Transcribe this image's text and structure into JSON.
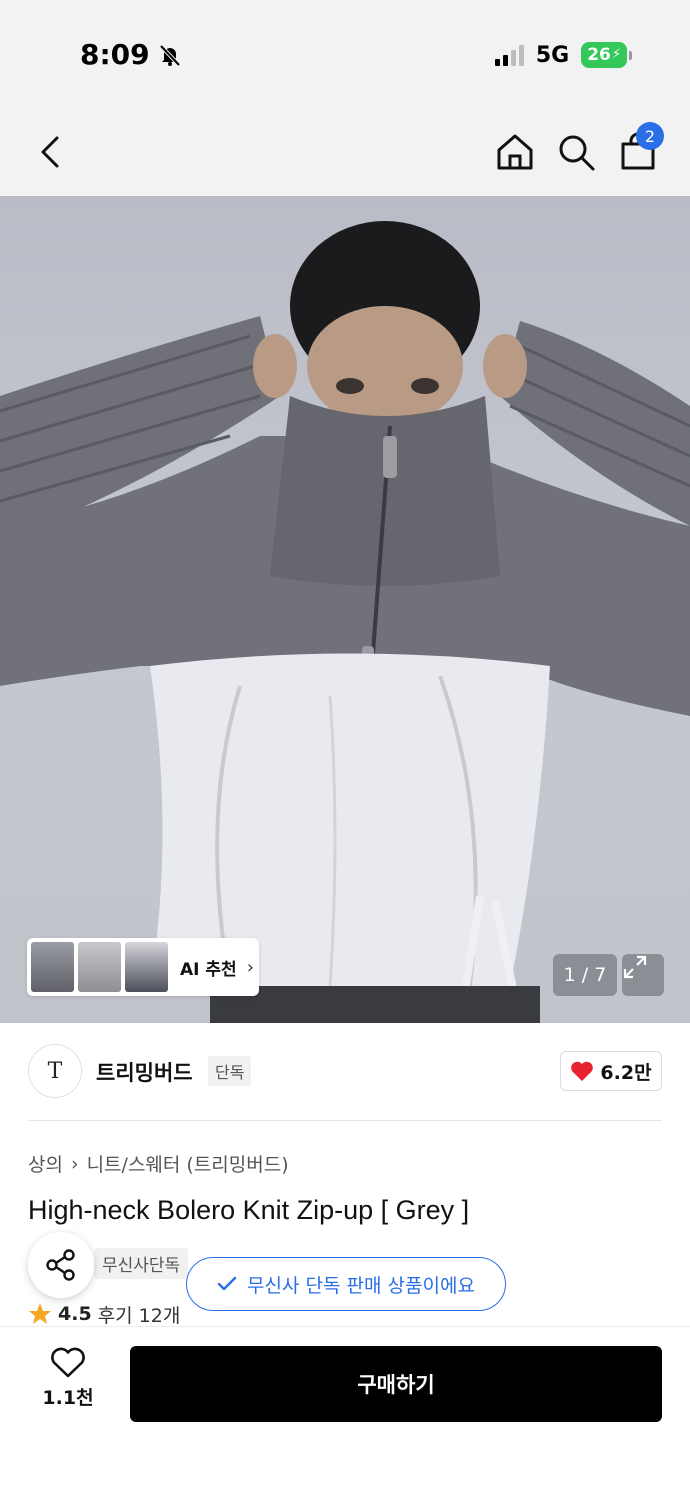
{
  "status_bar": {
    "time": "8:09",
    "network": "5G",
    "battery": "26",
    "icons": [
      "bell-slash-icon",
      "signal-icon",
      "battery-charging-icon"
    ]
  },
  "nav": {
    "cart_count": "2",
    "icons": [
      "back-icon",
      "home-icon",
      "search-icon",
      "bag-icon"
    ]
  },
  "gallery": {
    "ai_label": "AI 추천",
    "page_counter": "1 / 7"
  },
  "brand": {
    "logo_text": "T",
    "name": "트리밍버드",
    "tag": "단독",
    "likes": "6.2만"
  },
  "breadcrumb": {
    "category": "상의",
    "subcategory": "니트/스웨터 (트리밍버드)"
  },
  "product": {
    "title": "High-neck Bolero Knit Zip-up [ Grey ]",
    "exclusive_tag": "무신사단독",
    "exclusive_tooltip": "무신사 단독 판매 상품이에요",
    "rating": "4.5",
    "reviews": "후기 12개"
  },
  "bottom": {
    "wish_count": "1.1천",
    "buy_label": "구매하기"
  },
  "colors": {
    "accent_blue": "#2a6ee8",
    "heart_red": "#e8232f",
    "star_orange": "#f5a623",
    "battery_green": "#34c759"
  }
}
